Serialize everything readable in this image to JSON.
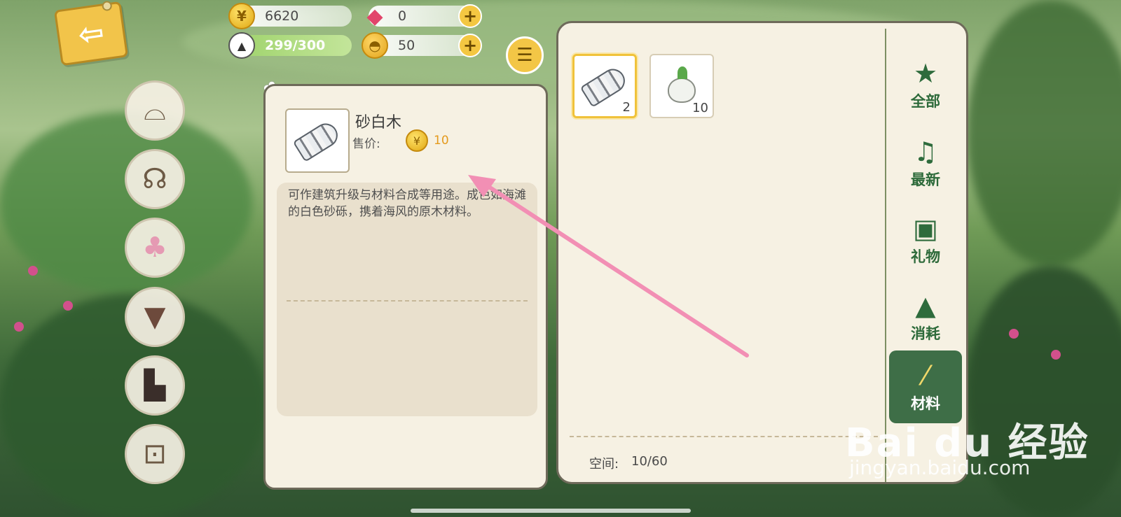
{
  "resources": {
    "coins": "6620",
    "gems": "0",
    "energy": "299/300",
    "shells": "50"
  },
  "detail": {
    "item_name": "砂白木",
    "price_label": "售价:",
    "price_value": "10",
    "description": "可作建筑升级与材料合成等用途。成色如海滩的白色砂砾，携着海风的原木材料。"
  },
  "inventory": {
    "slots": [
      {
        "name": "砂白木",
        "count": "2",
        "icon": "log-icon"
      },
      {
        "name": "萝卜",
        "count": "10",
        "icon": "radish-icon"
      }
    ],
    "space_label": "空间:",
    "space_value": "10/60"
  },
  "tabs": [
    {
      "label": "全部",
      "icon": "star-icon"
    },
    {
      "label": "最新",
      "icon": "bell-icon"
    },
    {
      "label": "礼物",
      "icon": "gift-icon"
    },
    {
      "label": "消耗",
      "icon": "onigiri-icon"
    },
    {
      "label": "材料",
      "icon": "log-icon",
      "active": true
    }
  ],
  "side_categories": [
    "hat-icon",
    "earmuffs-icon",
    "blouse-icon",
    "skirt-icon",
    "shoes-icon",
    "backpack-icon"
  ],
  "watermark": {
    "brand": "Bai du 经验",
    "url": "jingyan.baidu.com"
  },
  "colors": {
    "panel_bg": "#f6f1e3",
    "accent_gold": "#f3c646",
    "tab_green": "#2d6a3a",
    "annotation": "#f28fb4"
  }
}
